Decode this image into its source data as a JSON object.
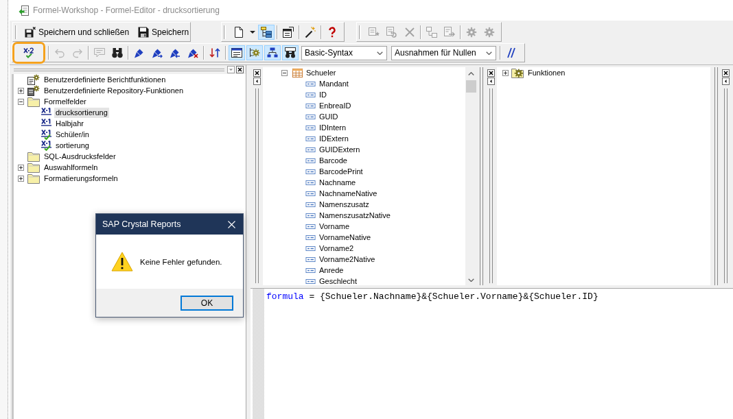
{
  "window": {
    "title": "Formel-Workshop - Formel-Editor - drucksortierung"
  },
  "toolbar_1": {
    "groups": [
      {
        "items": [
          {
            "kind": "saveclose",
            "label": "Speichern und schließen",
            "disabled": false,
            "pressed": false
          },
          {
            "kind": "save",
            "label": "Speichern",
            "disabled": false,
            "pressed": false
          }
        ]
      },
      {
        "items": [
          {
            "kind": "newdoc",
            "disabled": false,
            "pressed": false
          },
          {
            "kind": "caret",
            "disabled": false,
            "pressed": false
          },
          {
            "kind": "tree",
            "disabled": false,
            "pressed": true
          },
          {
            "kind": "separator"
          },
          {
            "kind": "properties",
            "disabled": false,
            "pressed": false
          },
          {
            "kind": "separator"
          },
          {
            "kind": "wand",
            "disabled": false,
            "pressed": false
          },
          {
            "kind": "separator"
          },
          {
            "kind": "help",
            "disabled": false,
            "pressed": false
          }
        ]
      },
      {
        "items": [
          {
            "kind": "insert",
            "disabled": true,
            "pressed": false
          },
          {
            "kind": "step",
            "disabled": true,
            "pressed": false
          },
          {
            "kind": "delete",
            "disabled": true,
            "pressed": false
          },
          {
            "kind": "separator"
          },
          {
            "kind": "expert",
            "disabled": true,
            "pressed": false
          },
          {
            "kind": "browse",
            "disabled": true,
            "pressed": false
          },
          {
            "kind": "separator"
          },
          {
            "kind": "gear",
            "disabled": true,
            "pressed": false
          },
          {
            "kind": "gears",
            "disabled": true,
            "pressed": false
          }
        ]
      }
    ]
  },
  "toolbar_2": {
    "items": [
      {
        "kind": "check",
        "disabled": false,
        "pressed": false,
        "highlighted": true
      },
      {
        "kind": "separator"
      },
      {
        "kind": "undo",
        "disabled": true,
        "pressed": false,
        "highlighted": false
      },
      {
        "kind": "redo",
        "disabled": true,
        "pressed": false,
        "highlighted": false
      },
      {
        "kind": "separator"
      },
      {
        "kind": "comment",
        "disabled": true,
        "pressed": false,
        "highlighted": false
      },
      {
        "kind": "find",
        "disabled": false,
        "pressed": false,
        "highlighted": false
      },
      {
        "kind": "separator"
      },
      {
        "kind": "bookmark",
        "disabled": false,
        "pressed": false,
        "highlighted": false
      },
      {
        "kind": "bookmarknext",
        "disabled": false,
        "pressed": false,
        "highlighted": false
      },
      {
        "kind": "bookmarkprev",
        "disabled": false,
        "pressed": false,
        "highlighted": false
      },
      {
        "kind": "bookmarkclear",
        "disabled": false,
        "pressed": false,
        "highlighted": false
      },
      {
        "kind": "separator"
      },
      {
        "kind": "sort",
        "disabled": false,
        "pressed": false,
        "highlighted": false
      },
      {
        "kind": "separator"
      },
      {
        "kind": "listview",
        "disabled": false,
        "pressed": true,
        "highlighted": false
      },
      {
        "kind": "geartree",
        "disabled": false,
        "pressed": true,
        "highlighted": false
      },
      {
        "kind": "nodes",
        "disabled": false,
        "pressed": true,
        "highlighted": false
      },
      {
        "kind": "windowfind",
        "disabled": false,
        "pressed": true,
        "highlighted": false
      },
      {
        "kind": "select",
        "value": "Basic-Syntax"
      },
      {
        "kind": "select",
        "value": "Ausnahmen für Nullen"
      },
      {
        "kind": "separator"
      },
      {
        "kind": "slashes",
        "disabled": false,
        "pressed": false,
        "highlighted": false
      }
    ]
  },
  "report_tree": {
    "items": [
      {
        "label": "Benutzerdefinierte Berichtfunktionen",
        "kind": "report",
        "selected": false
      },
      {
        "label": "Benutzerdefinierte Repository-Funktionen",
        "kind": "repository",
        "expanded": false,
        "selected": false
      },
      {
        "label": "Formelfelder",
        "kind": "folder",
        "expanded": true,
        "selected": false,
        "children": [
          {
            "label": "drucksortierung",
            "kind": "formula",
            "checked": false,
            "selected": true
          },
          {
            "label": "Halbjahr",
            "kind": "formula",
            "checked": false,
            "selected": false
          },
          {
            "label": "Schüler/in",
            "kind": "formula",
            "checked": true,
            "selected": false
          },
          {
            "label": "sortierung",
            "kind": "formula",
            "checked": true,
            "selected": false
          }
        ]
      },
      {
        "label": "SQL-Ausdrucksfelder",
        "kind": "folder",
        "selected": false
      },
      {
        "label": "Auswahlformeln",
        "kind": "folder",
        "expanded": false,
        "selected": false
      },
      {
        "label": "Formatierungsformeln",
        "kind": "folder",
        "expanded": false,
        "selected": false
      }
    ]
  },
  "field_tree": {
    "items": [
      {
        "label": "Schueler",
        "kind": "table",
        "expanded": true,
        "selected": false,
        "children": [
          {
            "label": "Mandant",
            "kind": "field",
            "selected": false
          },
          {
            "label": "ID",
            "kind": "field",
            "selected": false
          },
          {
            "label": "EnbreaID",
            "kind": "field",
            "selected": false
          },
          {
            "label": "GUID",
            "kind": "field",
            "selected": false
          },
          {
            "label": "IDIntern",
            "kind": "field",
            "selected": false
          },
          {
            "label": "IDExtern",
            "kind": "field",
            "selected": false
          },
          {
            "label": "GUIDExtern",
            "kind": "field",
            "selected": false
          },
          {
            "label": "Barcode",
            "kind": "field",
            "selected": false
          },
          {
            "label": "BarcodePrint",
            "kind": "field",
            "selected": false
          },
          {
            "label": "Nachname",
            "kind": "field",
            "selected": false
          },
          {
            "label": "NachnameNative",
            "kind": "field",
            "selected": false
          },
          {
            "label": "Namenszusatz",
            "kind": "field",
            "selected": false
          },
          {
            "label": "NamenszusatzNative",
            "kind": "field",
            "selected": false
          },
          {
            "label": "Vorname",
            "kind": "field",
            "selected": false
          },
          {
            "label": "VornameNative",
            "kind": "field",
            "selected": false
          },
          {
            "label": "Vorname2",
            "kind": "field",
            "selected": false
          },
          {
            "label": "Vorname2Native",
            "kind": "field",
            "selected": false
          },
          {
            "label": "Anrede",
            "kind": "field",
            "selected": false
          },
          {
            "label": "Geschlecht",
            "kind": "field",
            "selected": false
          }
        ]
      }
    ]
  },
  "function_tree": {
    "items": [
      {
        "label": "Funktionen",
        "kind": "functions",
        "expanded": false,
        "selected": false
      }
    ]
  },
  "editor": {
    "lines": [
      [
        {
          "kind": "keyword",
          "text": "formula"
        },
        {
          "kind": "plain",
          "text": " = {Schueler.Nachname}&{Schueler.Vorname}&{Schueler.ID}"
        }
      ]
    ]
  },
  "dialog": {
    "title": "SAP Crystal Reports",
    "kind": "warning",
    "message": "Keine Fehler gefunden.",
    "buttons": [
      {
        "label": "OK",
        "default": true
      }
    ]
  }
}
